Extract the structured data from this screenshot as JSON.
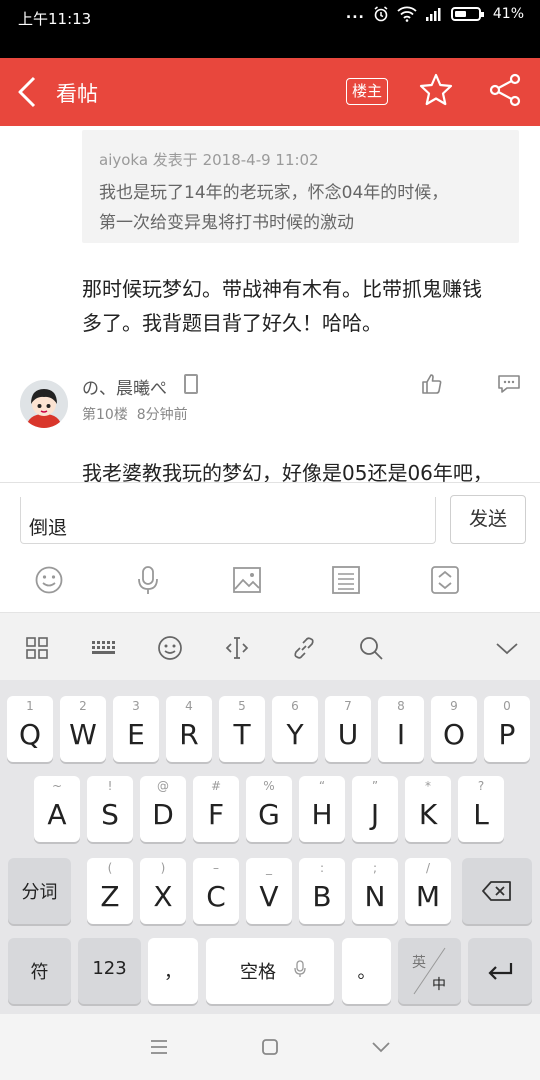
{
  "status": {
    "time": "上午11:13",
    "dots": "...",
    "battery": "41%"
  },
  "header": {
    "title": "看帖",
    "owner_label": "楼主",
    "accent": "#e8473d"
  },
  "quote": {
    "meta": "aiyoka 发表于 2018-4-9 11:02",
    "line1": "我也是玩了14年的老玩家，怀念04年的时候，",
    "line2": "第一次给变异鬼将打书时候的激动"
  },
  "post1": {
    "line1": "那时候玩梦幻。带战神有木有。比带抓鬼赚钱",
    "line2": "多了。我背题目背了好久！哈哈。"
  },
  "author": {
    "name": "の、晨曦ぺ",
    "floor": "第10楼",
    "time_ago": "8分钟前"
  },
  "post2": {
    "line1": "我老婆教我玩的梦幻，好像是05还是06年吧，"
  },
  "reply": {
    "input_value": "倒退",
    "send_label": "发送"
  },
  "keyboard": {
    "row1": [
      {
        "hint": "1",
        "key": "Q"
      },
      {
        "hint": "2",
        "key": "W"
      },
      {
        "hint": "3",
        "key": "E"
      },
      {
        "hint": "4",
        "key": "R"
      },
      {
        "hint": "5",
        "key": "T"
      },
      {
        "hint": "6",
        "key": "Y"
      },
      {
        "hint": "7",
        "key": "U"
      },
      {
        "hint": "8",
        "key": "I"
      },
      {
        "hint": "9",
        "key": "O"
      },
      {
        "hint": "0",
        "key": "P"
      }
    ],
    "row2": [
      {
        "hint": "~",
        "key": "A"
      },
      {
        "hint": "!",
        "key": "S"
      },
      {
        "hint": "@",
        "key": "D"
      },
      {
        "hint": "#",
        "key": "F"
      },
      {
        "hint": "%",
        "key": "G"
      },
      {
        "hint": "“",
        "key": "H"
      },
      {
        "hint": "”",
        "key": "J"
      },
      {
        "hint": "*",
        "key": "K"
      },
      {
        "hint": "?",
        "key": "L"
      }
    ],
    "row3": [
      {
        "hint": "(",
        "key": "Z"
      },
      {
        "hint": ")",
        "key": "X"
      },
      {
        "hint": "–",
        "key": "C"
      },
      {
        "hint": "_",
        "key": "V"
      },
      {
        "hint": ":",
        "key": "B"
      },
      {
        "hint": ";",
        "key": "N"
      },
      {
        "hint": "/",
        "key": "M"
      }
    ],
    "segment_label": "分词",
    "symbol_label": "符",
    "numbers_label": "123",
    "comma": "，",
    "space_label": "空格",
    "period": "。",
    "lang_top": "英",
    "lang_bottom": "中"
  }
}
